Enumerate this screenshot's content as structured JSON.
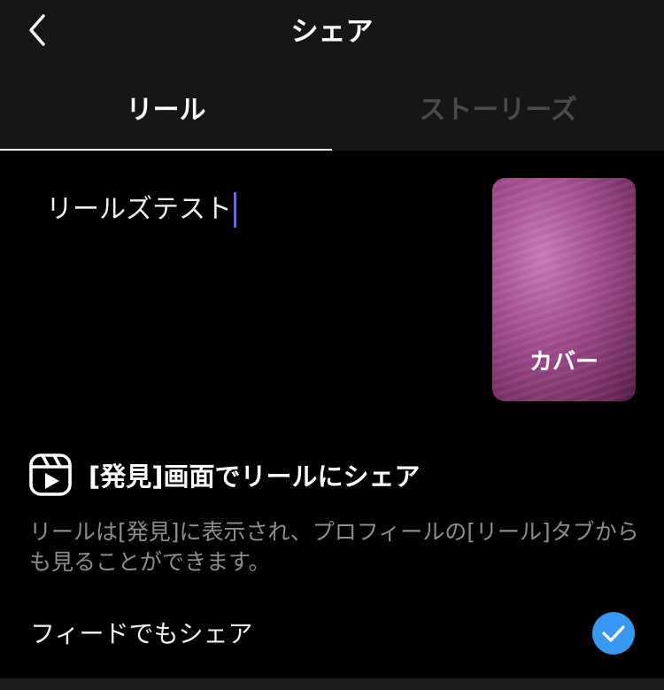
{
  "header": {
    "title": "シェア",
    "back_icon": "chevron-left-icon"
  },
  "tabs": [
    {
      "label": "リール",
      "active": true
    },
    {
      "label": "ストーリーズ",
      "active": false
    }
  ],
  "caption": {
    "value": "リールズテスト"
  },
  "cover": {
    "label": "カバー"
  },
  "share_reels": {
    "icon": "reels-icon",
    "label": "[発見]画面でリールにシェア"
  },
  "description": "リールは[発見]に表示され、プロフィールの[リール]タブからも見ることができます。",
  "feed_share": {
    "label": "フィードでもシェア",
    "checked": true
  },
  "colors": {
    "accent": "#3897f0",
    "cursor": "#5b6cf2",
    "background": "#000000",
    "header_bg": "#161616"
  }
}
